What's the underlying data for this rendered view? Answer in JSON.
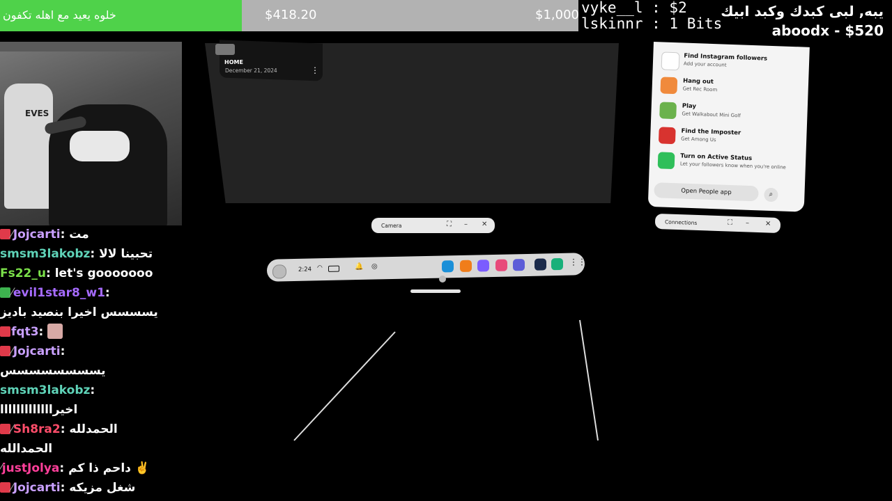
{
  "goal": {
    "title": "خلوه يعيد مع اهله تكفون",
    "current": "$418.20",
    "target": "$1,000",
    "progress": 0.418
  },
  "tips": {
    "line1": "vyke__l : $2",
    "line2": "lskinnr : 1 Bits",
    "top_line1": "يبه, لبى كبدك وكبد ابيك",
    "top_line2": "aboodx - $520"
  },
  "webcam": {
    "chair_logo": "EVES"
  },
  "chat": [
    {
      "user": "Jojcarti",
      "user_color": "#c9a0ff",
      "badges": [
        "red",
        "slash"
      ],
      "text": "مت"
    },
    {
      "user": "smsm3lakobz",
      "user_color": "#5fd3b8",
      "badges": [],
      "text": "تحبينا لالا"
    },
    {
      "user": "Fs22_u",
      "user_color": "#7be04a",
      "badges": [],
      "text": "let's gooooooo"
    },
    {
      "user": "evil1star8_w1",
      "user_color": "#a66bff",
      "badges": [
        "green",
        "slash"
      ],
      "text": ""
    },
    {
      "user": "",
      "user_color": "#ffffff",
      "badges": [],
      "text": "يسسسس اخيرا بنصيد باديز"
    },
    {
      "user": "fqt3",
      "user_color": "#c9a0ff",
      "badges": [
        "red"
      ],
      "text": "",
      "emote": true
    },
    {
      "user": "Jojcarti",
      "user_color": "#c9a0ff",
      "badges": [
        "red",
        "slash"
      ],
      "text": ""
    },
    {
      "user": "",
      "user_color": "#ffffff",
      "badges": [],
      "text": "يسسسسسسسس"
    },
    {
      "user": "smsm3lakobz",
      "user_color": "#5fd3b8",
      "badges": [],
      "text": ""
    },
    {
      "user": "",
      "user_color": "#ffffff",
      "badges": [],
      "text": "اخيرااااااااااااا"
    },
    {
      "user": "Sh8ra2",
      "user_color": "#ff4d6a",
      "badges": [
        "red",
        "slash"
      ],
      "text": "الحمدلله"
    },
    {
      "user": "",
      "user_color": "#ffffff",
      "badges": [],
      "text": "الحمدالله"
    },
    {
      "user": "justJolya",
      "user_color": "#ff3f9a",
      "badges": [
        "slash"
      ],
      "text": "داحم ذا كم ✌️"
    },
    {
      "user": "Jojcarti",
      "user_color": "#c9a0ff",
      "badges": [
        "red",
        "slash"
      ],
      "text": "شغل مزيكه"
    }
  ],
  "home_card": {
    "label": "HOME",
    "date": "December 21, 2024"
  },
  "people_panel": {
    "items": [
      {
        "title": "Find Instagram followers",
        "sub": "Add your account",
        "color": "#ffffff"
      },
      {
        "title": "Hang out",
        "sub": "Get Rec Room",
        "color": "#f08a3c"
      },
      {
        "title": "Play",
        "sub": "Get Walkabout Mini Golf",
        "color": "#6bb24c"
      },
      {
        "title": "Find the Imposter",
        "sub": "Get Among Us",
        "color": "#d8332f"
      },
      {
        "title": "Turn on Active Status",
        "sub": "Let your followers know when you're online",
        "color": "#2fbf5a"
      }
    ],
    "open_button": "Open People app"
  },
  "windows": {
    "camera_title": "Camera",
    "connections_title": "Connections"
  },
  "taskbar": {
    "time": "2:24",
    "apps": [
      {
        "name": "browser",
        "color": "#1a8fd8"
      },
      {
        "name": "store",
        "color": "#f07d1a"
      },
      {
        "name": "people",
        "color": "#7b5cff"
      },
      {
        "name": "camera",
        "color": "#e84a7a"
      },
      {
        "name": "horizon",
        "color": "#5d5dd8"
      },
      {
        "name": "steam",
        "color": "#1b2a4a"
      },
      {
        "name": "settings",
        "color": "#18b07a"
      }
    ]
  }
}
